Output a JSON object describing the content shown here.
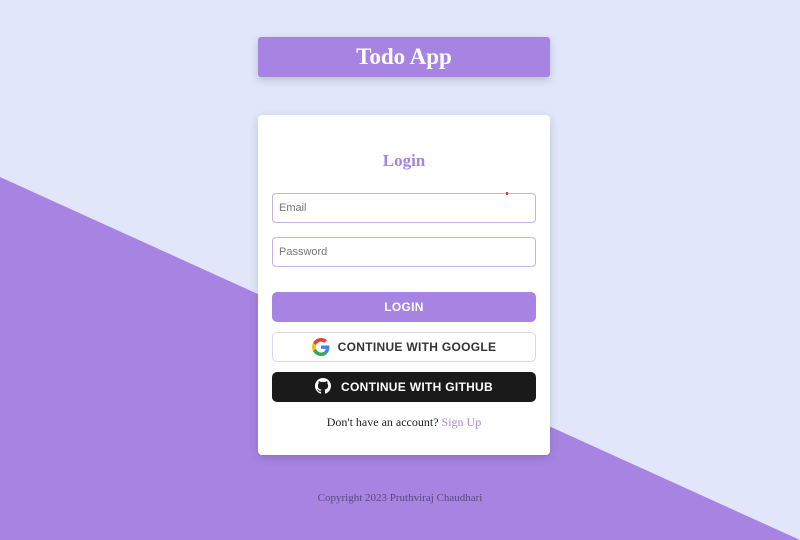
{
  "colors": {
    "background_light": "#e2e6fb",
    "background_purple": "#a784e2",
    "accent": "#a784e2",
    "github_button": "#1a1a1a"
  },
  "header": {
    "title": "Todo App"
  },
  "login_card": {
    "title": "Login",
    "email": {
      "placeholder": "Email",
      "value": ""
    },
    "password": {
      "placeholder": "Password",
      "value": ""
    },
    "login_button": "LOGIN",
    "google_button": {
      "label": "CONTINUE WITH GOOGLE",
      "icon": "google-icon"
    },
    "github_button": {
      "label": "CONTINUE WITH GITHUB",
      "icon": "github-icon"
    },
    "signup_prompt": "Don't have an account?",
    "signup_link": "Sign Up"
  },
  "footer": {
    "copyright": "Copyright 2023 Pruthviraj Chaudhari"
  }
}
